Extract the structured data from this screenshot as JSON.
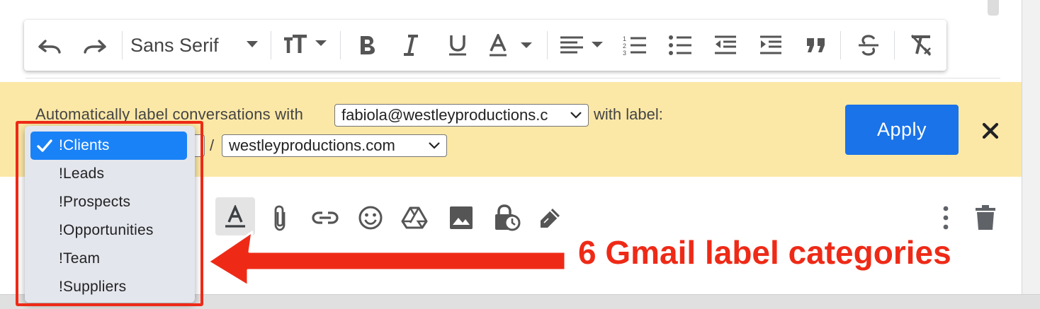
{
  "toolbar": {
    "font_name": "Sans Serif"
  },
  "label_bar": {
    "auto_label_text": "Automatically label conversations with",
    "sender_value": "fabiola@westleyproductions.c",
    "with_label_text": "with label:",
    "separator": "/",
    "sublabel_value": "westleyproductions.com",
    "apply_label": "Apply"
  },
  "dropdown": {
    "selected": "!Clients",
    "options": [
      "!Leads",
      "!Prospects",
      "!Opportunities",
      "!Team",
      "!Suppliers"
    ]
  },
  "annotation": {
    "text": "6 Gmail label categories",
    "color": "#ee2a17"
  },
  "colors": {
    "accent": "#1a73e8",
    "label_bar": "#fbe8a6",
    "dropdown_selected": "#1a82f7"
  }
}
